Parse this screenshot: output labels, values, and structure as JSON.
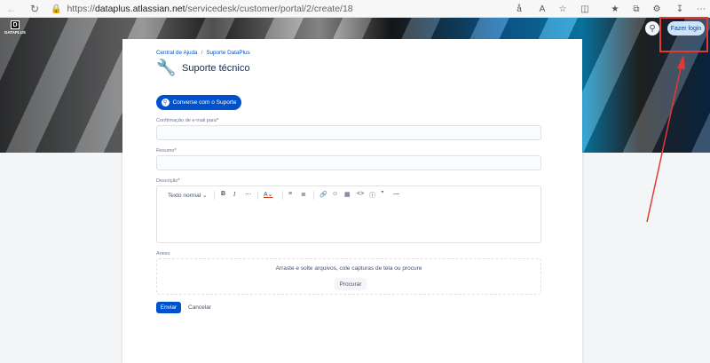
{
  "browser": {
    "url_host": "dataplus.atlassian.net",
    "url_path": "/servicedesk/customer/portal/2/create/18",
    "icons": [
      "back-icon",
      "reload-icon",
      "lock-icon",
      "read-aloud-icon",
      "text-size-icon",
      "favorite-icon",
      "split-screen-icon",
      "favorites-icon",
      "collections-icon",
      "extensions-icon",
      "more-icon"
    ]
  },
  "header": {
    "logo_text": "DATAPLUS",
    "login_label": "Fazer login"
  },
  "breadcrumb": [
    "Central de Ajuda",
    "Suporte DataPlus"
  ],
  "page": {
    "title": "Suporte técnico",
    "chat_button": "Converse com o Suporte"
  },
  "form": {
    "email_label": "Confirmação de e-mail para",
    "summary_label": "Resumo",
    "description_label": "Descrição",
    "text_style": "Texto normal",
    "attachment_label": "Anexo",
    "dropzone_text": "Arraste e solte arquivos, cole capturas de tela ou procure",
    "browse_label": "Procurar",
    "submit_label": "Enviar",
    "cancel_label": "Cancelar",
    "required_mark": "*"
  },
  "colors": {
    "primary": "#0052cc",
    "highlight": "#e53935"
  }
}
